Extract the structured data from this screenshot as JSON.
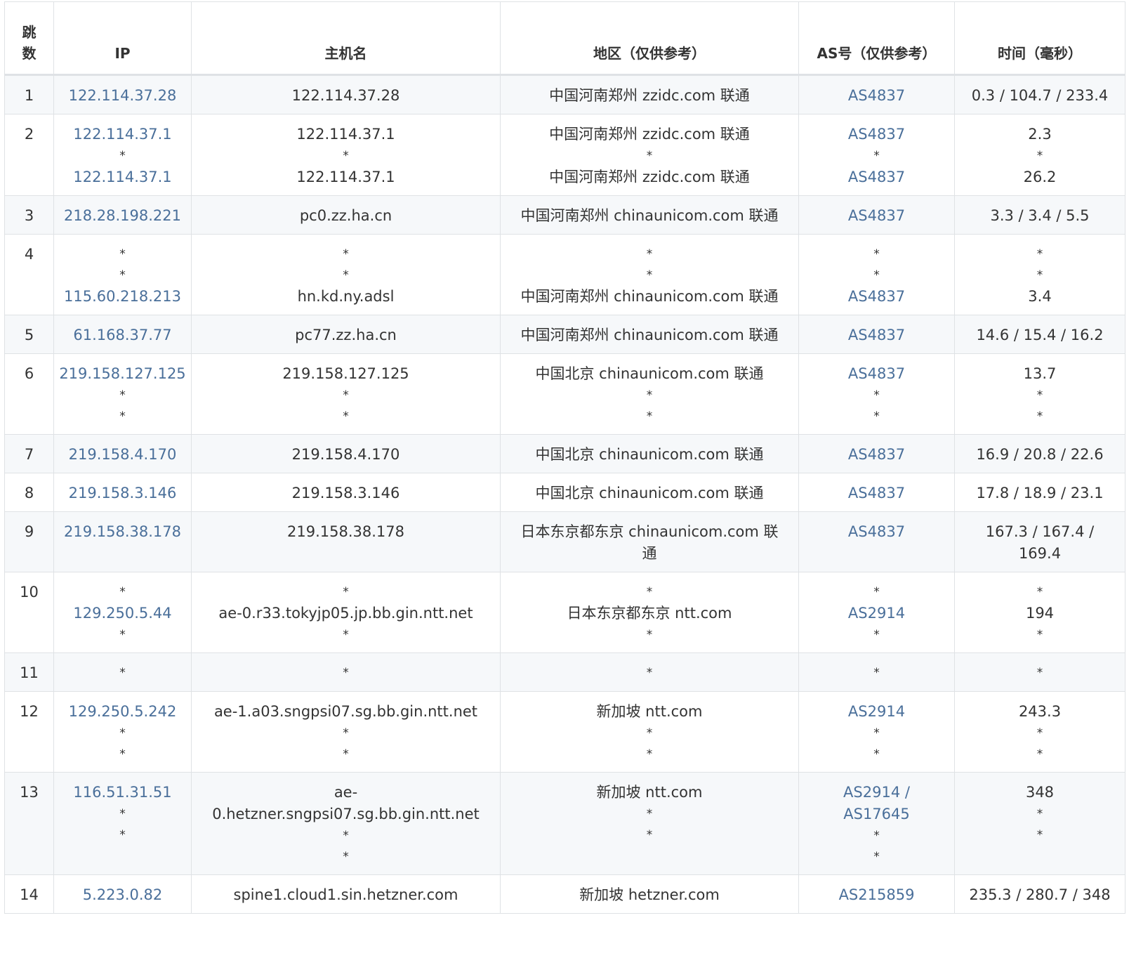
{
  "header": {
    "hop": "跳数",
    "ip": "IP",
    "host": "主机名",
    "region": "地区（仅供参考）",
    "as": "AS号（仅供参考）",
    "time": "时间（毫秒）"
  },
  "rows": [
    {
      "hop": "1",
      "ip": [
        "122.114.37.28"
      ],
      "host": [
        "122.114.37.28"
      ],
      "region": [
        "中国河南郑州 zzidc.com 联通"
      ],
      "as": [
        "AS4837"
      ],
      "time": [
        "0.3 / 104.7 / 233.4"
      ]
    },
    {
      "hop": "2",
      "ip": [
        "122.114.37.1",
        "*",
        "122.114.37.1"
      ],
      "host": [
        "122.114.37.1",
        "*",
        "122.114.37.1"
      ],
      "region": [
        "中国河南郑州 zzidc.com 联通",
        "*",
        "中国河南郑州 zzidc.com 联通"
      ],
      "as": [
        "AS4837",
        "*",
        "AS4837"
      ],
      "time": [
        "2.3",
        "*",
        "26.2"
      ]
    },
    {
      "hop": "3",
      "ip": [
        "218.28.198.221"
      ],
      "host": [
        "pc0.zz.ha.cn"
      ],
      "region": [
        "中国河南郑州 chinaunicom.com 联通"
      ],
      "as": [
        "AS4837"
      ],
      "time": [
        "3.3 / 3.4 / 5.5"
      ]
    },
    {
      "hop": "4",
      "ip": [
        "*",
        "*",
        "115.60.218.213"
      ],
      "host": [
        "*",
        "*",
        "hn.kd.ny.adsl"
      ],
      "region": [
        "*",
        "*",
        "中国河南郑州 chinaunicom.com 联通"
      ],
      "as": [
        "*",
        "*",
        "AS4837"
      ],
      "time": [
        "*",
        "*",
        "3.4"
      ]
    },
    {
      "hop": "5",
      "ip": [
        "61.168.37.77"
      ],
      "host": [
        "pc77.zz.ha.cn"
      ],
      "region": [
        "中国河南郑州 chinaunicom.com 联通"
      ],
      "as": [
        "AS4837"
      ],
      "time": [
        "14.6 / 15.4 / 16.2"
      ]
    },
    {
      "hop": "6",
      "ip": [
        "219.158.127.125",
        "*",
        "*"
      ],
      "host": [
        "219.158.127.125",
        "*",
        "*"
      ],
      "region": [
        "中国北京 chinaunicom.com 联通",
        "*",
        "*"
      ],
      "as": [
        "AS4837",
        "*",
        "*"
      ],
      "time": [
        "13.7",
        "*",
        "*"
      ]
    },
    {
      "hop": "7",
      "ip": [
        "219.158.4.170"
      ],
      "host": [
        "219.158.4.170"
      ],
      "region": [
        "中国北京 chinaunicom.com 联通"
      ],
      "as": [
        "AS4837"
      ],
      "time": [
        "16.9 / 20.8 / 22.6"
      ]
    },
    {
      "hop": "8",
      "ip": [
        "219.158.3.146"
      ],
      "host": [
        "219.158.3.146"
      ],
      "region": [
        "中国北京 chinaunicom.com 联通"
      ],
      "as": [
        "AS4837"
      ],
      "time": [
        "17.8 / 18.9 / 23.1"
      ]
    },
    {
      "hop": "9",
      "ip": [
        "219.158.38.178"
      ],
      "host": [
        "219.158.38.178"
      ],
      "region": [
        "日本东京都东京 chinaunicom.com 联",
        "通"
      ],
      "as": [
        "AS4837"
      ],
      "time": [
        "167.3 / 167.4 /",
        "169.4"
      ]
    },
    {
      "hop": "10",
      "ip": [
        "*",
        "129.250.5.44",
        "*"
      ],
      "host": [
        "*",
        "ae-0.r33.tokyjp05.jp.bb.gin.ntt.net",
        "*"
      ],
      "region": [
        "*",
        "日本东京都东京 ntt.com",
        "*"
      ],
      "as": [
        "*",
        "AS2914",
        "*"
      ],
      "time": [
        "*",
        "194",
        "*"
      ]
    },
    {
      "hop": "11",
      "ip": [
        "*"
      ],
      "host": [
        "*"
      ],
      "region": [
        "*"
      ],
      "as": [
        "*"
      ],
      "time": [
        "*"
      ]
    },
    {
      "hop": "12",
      "ip": [
        "129.250.5.242",
        "*",
        "*"
      ],
      "host": [
        "ae-1.a03.sngpsi07.sg.bb.gin.ntt.net",
        "*",
        "*"
      ],
      "region": [
        "新加坡 ntt.com",
        "*",
        "*"
      ],
      "as": [
        "AS2914",
        "*",
        "*"
      ],
      "time": [
        "243.3",
        "*",
        "*"
      ]
    },
    {
      "hop": "13",
      "ip": [
        "116.51.31.51",
        "*",
        "*"
      ],
      "host": [
        "ae-",
        "0.hetzner.sngpsi07.sg.bb.gin.ntt.net",
        "*",
        "*"
      ],
      "region": [
        "新加坡 ntt.com",
        "*",
        "*"
      ],
      "as": [
        "AS2914 /",
        "AS17645",
        "*",
        "*"
      ],
      "time": [
        "348",
        "*",
        "*"
      ]
    },
    {
      "hop": "14",
      "ip": [
        "5.223.0.82"
      ],
      "host": [
        "spine1.cloud1.sin.hetzner.com"
      ],
      "region": [
        "新加坡 hetzner.com"
      ],
      "as": [
        "AS215859"
      ],
      "time": [
        "235.3 / 280.7 / 348"
      ]
    }
  ]
}
